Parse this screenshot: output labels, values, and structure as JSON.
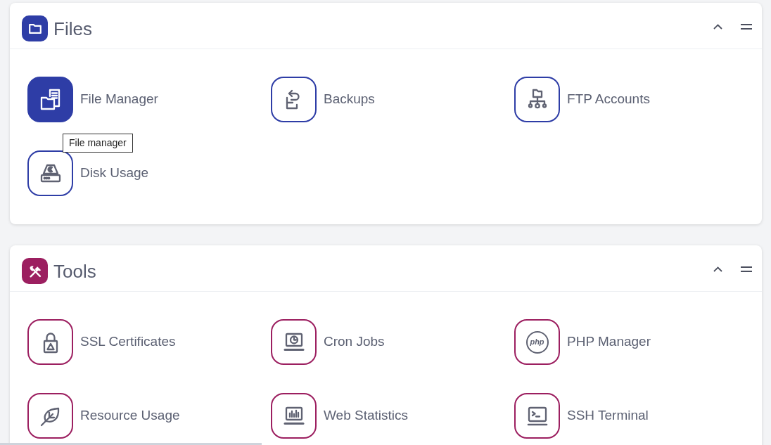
{
  "sections": [
    {
      "title": "Files",
      "color": "#2e3da6",
      "expanded": true,
      "items": [
        {
          "label": "File Manager",
          "highlighted": true,
          "tooltip": "File manager"
        },
        {
          "label": "Backups",
          "highlighted": false
        },
        {
          "label": "FTP Accounts",
          "highlighted": false
        },
        {
          "label": "Disk Usage",
          "highlighted": false
        }
      ]
    },
    {
      "title": "Tools",
      "color": "#9c1f60",
      "expanded": true,
      "items": [
        {
          "label": "SSL Certificates",
          "highlighted": false
        },
        {
          "label": "Cron Jobs",
          "highlighted": false
        },
        {
          "label": "PHP Manager",
          "highlighted": false,
          "icon_text": "php"
        },
        {
          "label": "Resource Usage",
          "highlighted": false
        },
        {
          "label": "Web Statistics",
          "highlighted": false
        },
        {
          "label": "SSH Terminal",
          "highlighted": false
        }
      ]
    }
  ]
}
